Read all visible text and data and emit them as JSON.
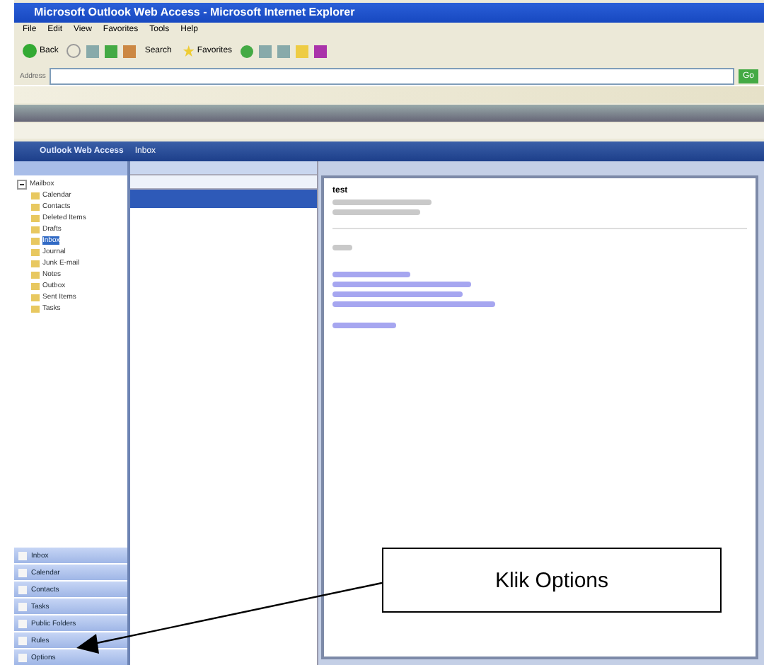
{
  "window": {
    "title": "Microsoft Outlook Web Access - Microsoft Internet Explorer"
  },
  "menu": [
    "File",
    "Edit",
    "View",
    "Favorites",
    "Tools",
    "Help"
  ],
  "toolbar": {
    "back": "Back",
    "search": "Search",
    "favorites": "Favorites"
  },
  "address": {
    "label": "Address",
    "go": "Go"
  },
  "owa": {
    "title": "Outlook Web Access",
    "folder": "Inbox"
  },
  "folders": [
    {
      "label": "Mailbox",
      "expanded": true,
      "children": [
        {
          "label": "Calendar",
          "selected": false
        },
        {
          "label": "Contacts",
          "selected": false
        },
        {
          "label": "Deleted Items",
          "selected": false
        },
        {
          "label": "Drafts",
          "selected": false
        },
        {
          "label": "Inbox",
          "selected": true
        },
        {
          "label": "Journal",
          "selected": false
        },
        {
          "label": "Junk E-mail",
          "selected": false
        },
        {
          "label": "Notes",
          "selected": false
        },
        {
          "label": "Outbox",
          "selected": false
        },
        {
          "label": "Sent Items",
          "selected": false
        },
        {
          "label": "Tasks",
          "selected": false
        }
      ]
    }
  ],
  "messages": [
    {
      "selected": true
    }
  ],
  "email": {
    "subject": "test"
  },
  "nav": [
    {
      "label": "Inbox"
    },
    {
      "label": "Calendar"
    },
    {
      "label": "Contacts"
    },
    {
      "label": "Tasks"
    },
    {
      "label": "Public Folders"
    },
    {
      "label": "Rules"
    },
    {
      "label": "Options"
    }
  ],
  "callout": {
    "text": "Klik Options"
  }
}
